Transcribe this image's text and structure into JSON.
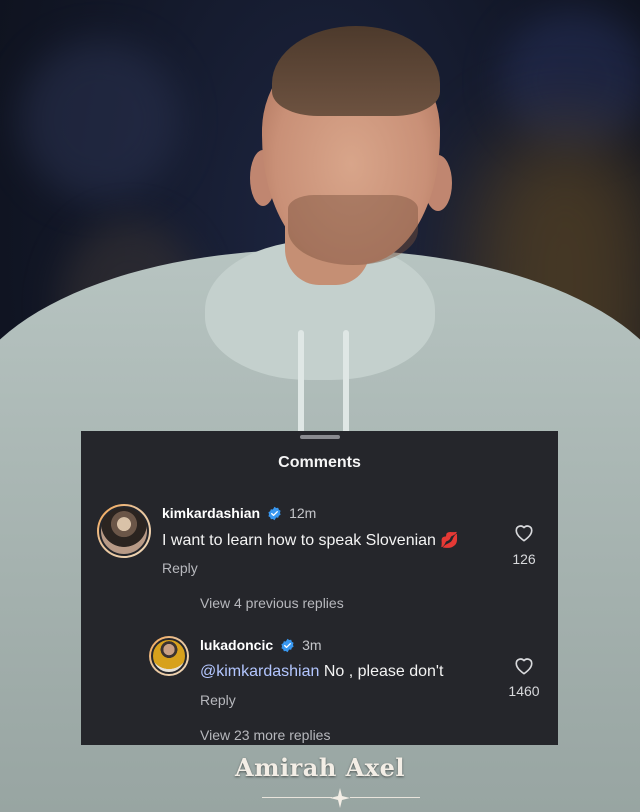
{
  "comments_panel": {
    "title": "Comments",
    "comments": [
      {
        "username": "kimkardashian",
        "time": "12m",
        "text": "I want to learn how to speak Slovenian",
        "emoji": "💋",
        "reply_label": "Reply",
        "likes": "126"
      }
    ],
    "view_previous": "View 4 previous replies",
    "replies": [
      {
        "username": "lukadoncic",
        "time": "3m",
        "mention": "@kimkardashian",
        "text": " No , please don't",
        "reply_label": "Reply",
        "likes": "1460"
      }
    ],
    "view_more": "View 23 more replies"
  },
  "watermark": {
    "text": "Amirah Axel"
  },
  "colors": {
    "panel_bg": "#25262b",
    "verified_blue": "#3897f0",
    "mention": "#b3c6ff",
    "hoodie": "#b7c4c1"
  },
  "icons": [
    "verified-badge-icon",
    "heart-icon",
    "kiss-lips-emoji",
    "sparkle-star-icon"
  ]
}
